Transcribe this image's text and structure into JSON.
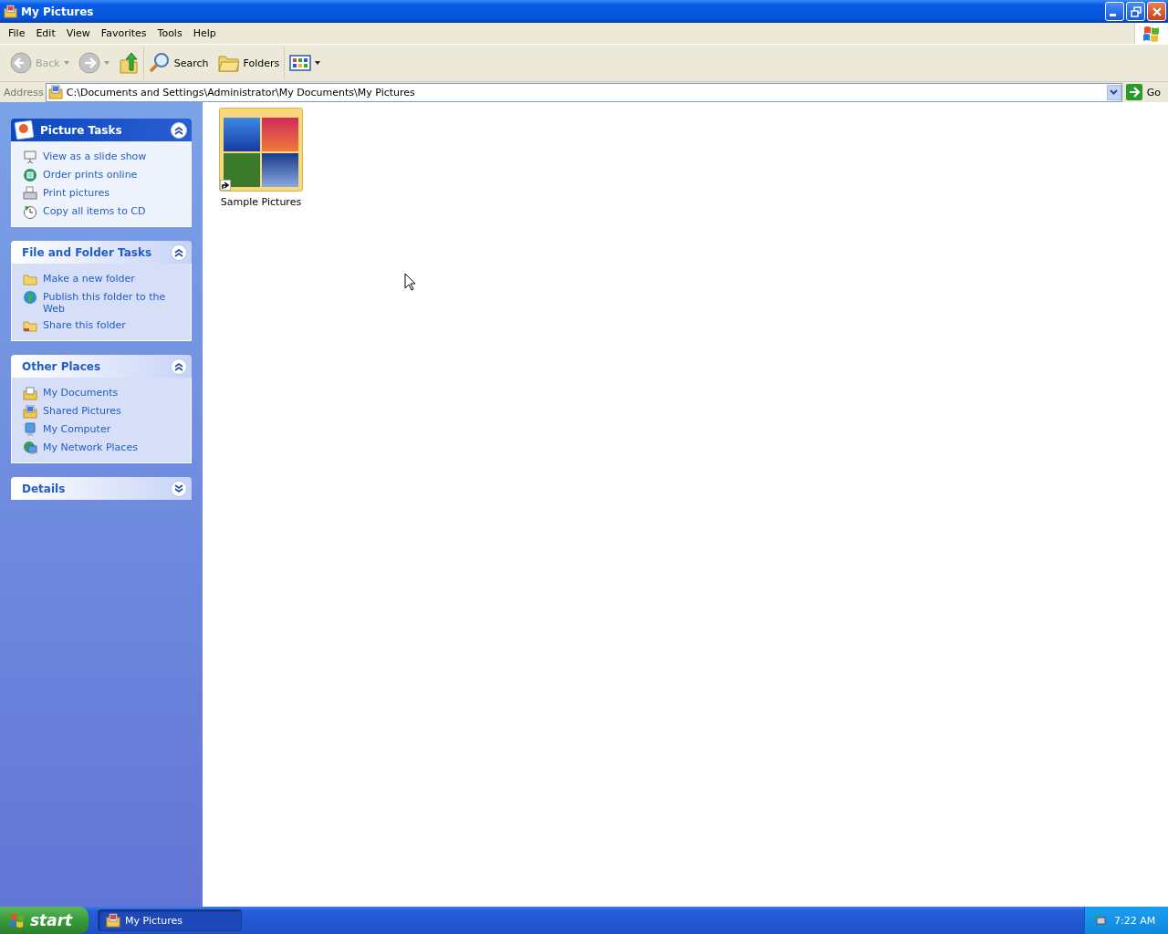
{
  "window": {
    "title": "My Pictures"
  },
  "menu": [
    "File",
    "Edit",
    "View",
    "Favorites",
    "Tools",
    "Help"
  ],
  "toolbar": [
    {
      "kind": "back",
      "label": "Back",
      "disabled": true
    },
    {
      "kind": "forward",
      "disabled": true
    },
    {
      "kind": "up"
    },
    {
      "kind": "search",
      "label": "Search"
    },
    {
      "kind": "folders",
      "label": "Folders"
    },
    {
      "kind": "views"
    }
  ],
  "address": {
    "label": "Address",
    "value": "C:\\Documents and Settings\\Administrator\\My Documents\\My Pictures",
    "go": "Go"
  },
  "panels": [
    {
      "kind": "special",
      "title": "Picture Tasks",
      "expanded": true,
      "items": [
        {
          "kind": "slideshow",
          "label": "View as a slide show"
        },
        {
          "kind": "prints",
          "label": "Order prints online"
        },
        {
          "kind": "printer",
          "label": "Print pictures"
        },
        {
          "kind": "cd",
          "label": "Copy all items to CD"
        }
      ]
    },
    {
      "kind": "normal",
      "title": "File and Folder Tasks",
      "expanded": true,
      "items": [
        {
          "kind": "newfolder",
          "label": "Make a new folder"
        },
        {
          "kind": "web",
          "label": "Publish this folder to the Web"
        },
        {
          "kind": "share",
          "label": "Share this folder"
        }
      ]
    },
    {
      "kind": "normal",
      "title": "Other Places",
      "expanded": true,
      "items": [
        {
          "kind": "docs",
          "label": "My Documents"
        },
        {
          "kind": "shared",
          "label": "Shared Pictures"
        },
        {
          "kind": "computer",
          "label": "My Computer"
        },
        {
          "kind": "network",
          "label": "My Network Places"
        }
      ]
    },
    {
      "kind": "normal",
      "title": "Details",
      "expanded": false
    }
  ],
  "files": [
    {
      "label": "Sample Pictures",
      "shortcut": true
    }
  ],
  "taskbar": {
    "start": "start",
    "tasks": [
      {
        "label": "My Pictures",
        "selected": true
      }
    ],
    "clock": "7:22 AM"
  }
}
